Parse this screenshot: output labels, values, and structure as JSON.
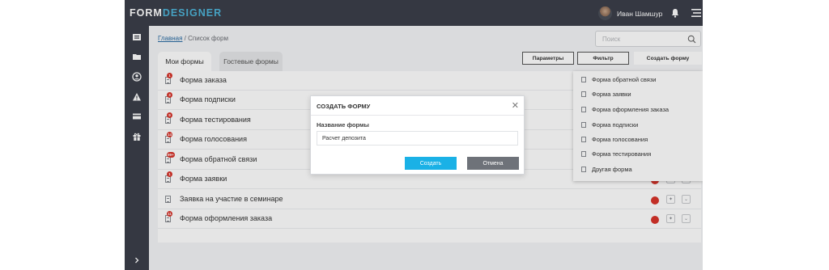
{
  "app": {
    "logo_part1": "FORM",
    "logo_part2": "DESIGNER",
    "brand_color": "#4fb4d8",
    "sidebar_color": "#3b3f4a"
  },
  "header": {
    "user_name": "Иван Шамшур"
  },
  "sidebar": {
    "icons": [
      "forms-icon",
      "folder-icon",
      "user-icon",
      "warning-icon",
      "card-icon",
      "gift-icon"
    ],
    "expand_icon": "chevron-right-icon"
  },
  "breadcrumb": {
    "home": "Главная",
    "separator": " / ",
    "current": "Список форм"
  },
  "search": {
    "placeholder": "Поиск"
  },
  "tabs": [
    {
      "label": "Мои формы",
      "active": true
    },
    {
      "label": "Гостевые формы",
      "active": false
    }
  ],
  "toolbar": {
    "params_label": "Параметры",
    "filter_label": "Фильтр",
    "create_label": "Создать форму"
  },
  "forms": [
    {
      "name": "Форма заказа",
      "badge": "1"
    },
    {
      "name": "Форма подписки",
      "badge": "3"
    },
    {
      "name": "Форма тестирования",
      "badge": "9"
    },
    {
      "name": "Форма голосования",
      "badge": "14"
    },
    {
      "name": "Форма обратной связи",
      "badge": "99+"
    },
    {
      "name": "Форма заявки",
      "badge": "1"
    },
    {
      "name": "Заявка на участие в семинаре",
      "badge": ""
    },
    {
      "name": "Форма оформления заказа",
      "badge": "11"
    }
  ],
  "create_menu": [
    "Форма обратной связи",
    "Форма заявки",
    "Форма оформления заказа",
    "Форма подписки",
    "Форма голосования",
    "Форма тестирования",
    "Другая форма"
  ],
  "modal": {
    "title": "СОЗДАТЬ ФОРМУ",
    "field_label": "Название формы",
    "field_value": "Расчет депозита",
    "create_label": "Создать",
    "cancel_label": "Отмена"
  },
  "colors": {
    "status_red": "#d9342b",
    "primary_button": "#1ab1e6",
    "secondary_button": "#6e7279"
  }
}
